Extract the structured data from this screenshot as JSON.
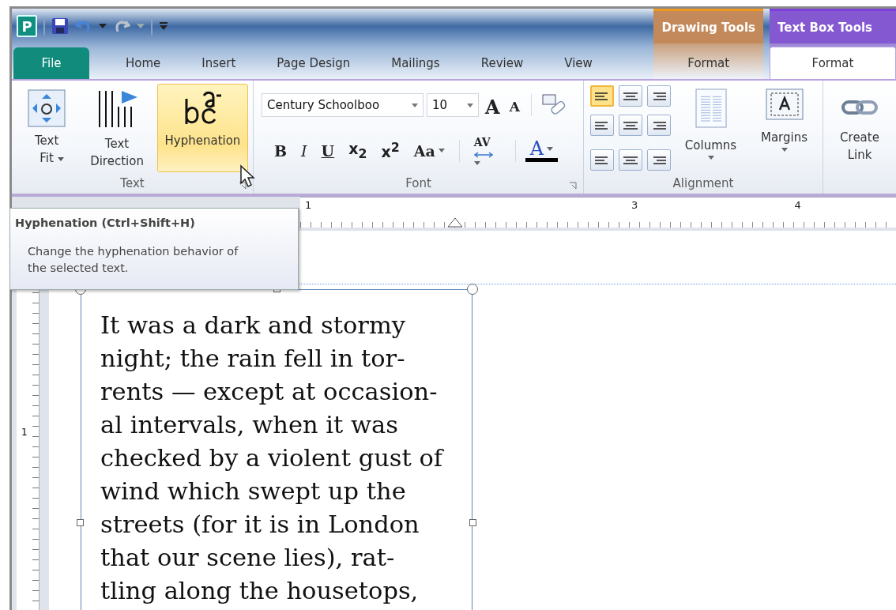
{
  "app_logo": "P",
  "contextual_tabs": [
    {
      "label": "Drawing Tools",
      "color": "#c4895a",
      "tabs": [
        {
          "label": "Format",
          "selected": false
        }
      ]
    },
    {
      "label": "Text Box Tools",
      "color": "#8358d0",
      "tabs": [
        {
          "label": "Format",
          "selected": true
        }
      ]
    }
  ],
  "tabs": [
    {
      "label": "File",
      "kind": "file",
      "selected": false
    },
    {
      "label": "Home",
      "kind": "plain",
      "selected": false
    },
    {
      "label": "Insert",
      "kind": "plain",
      "selected": false
    },
    {
      "label": "Page Design",
      "kind": "plain",
      "selected": false
    },
    {
      "label": "Mailings",
      "kind": "plain",
      "selected": false
    },
    {
      "label": "Review",
      "kind": "plain",
      "selected": false
    },
    {
      "label": "View",
      "kind": "plain",
      "selected": false
    }
  ],
  "ribbon": {
    "text_group": {
      "label": "Text",
      "buttons": [
        {
          "label": "Text Fit",
          "kind": "fit",
          "dropdown": true,
          "highlighted": false
        },
        {
          "label": "Text Direction",
          "kind": "direction",
          "dropdown": false,
          "highlighted": false
        },
        {
          "label": "Hyphenation",
          "kind": "hyphen",
          "dropdown": false,
          "highlighted": true
        }
      ]
    },
    "font_group": {
      "label": "Font",
      "font_name": "Century Schoolboo",
      "font_size": "10",
      "size_buttons": [
        {
          "label": "A",
          "kind": "grow"
        },
        {
          "label": "A",
          "kind": "shrink"
        }
      ],
      "format_buttons": [
        {
          "label": "B",
          "kind": "bold",
          "dropdown": false
        },
        {
          "label": "I",
          "kind": "italic",
          "dropdown": false
        },
        {
          "label": "U",
          "kind": "underline",
          "dropdown": false
        },
        {
          "label": "x$_{2}$",
          "kind": "script",
          "dropdown": false
        },
        {
          "label": "x$^{2}$",
          "kind": "script",
          "dropdown": false
        },
        {
          "label": "Aa",
          "kind": "case",
          "dropdown": true
        },
        {
          "label": "AV",
          "kind": "spacing",
          "dropdown": true
        },
        {
          "label": "A",
          "kind": "color",
          "dropdown": true
        }
      ]
    },
    "alignment_group": {
      "label": "Alignment",
      "align_buttons": [
        {
          "selected": true
        },
        {
          "selected": false
        },
        {
          "selected": false
        },
        {
          "selected": false
        },
        {
          "selected": false
        },
        {
          "selected": false
        },
        {
          "selected": false
        },
        {
          "selected": false
        },
        {
          "selected": false
        }
      ],
      "buttons": [
        {
          "label": "Columns",
          "kind": "columns"
        },
        {
          "label": "Margins",
          "kind": "margins"
        }
      ]
    },
    "link_group": {
      "buttons": [
        {
          "label": "Create Link"
        }
      ]
    }
  },
  "tooltip": {
    "title": "Hyphenation (Ctrl+Shift+H)",
    "description": "Change the hyphenation behavior of the selected text."
  },
  "horizontal_ruler": {
    "numbers": [
      "1",
      "3",
      "4"
    ]
  },
  "vertical_ruler": {
    "numbers": [
      "1"
    ]
  },
  "text_box": {
    "lines": [
      "It was a dark and stormy",
      "night; the rain fell in tor-",
      "rents — except at occasion-",
      "al intervals, when it was",
      "checked by a violent gust of",
      "wind which swept up the",
      "streets (for it is in London",
      "that our scene lies), rat-",
      "tling along the housetops,"
    ]
  }
}
